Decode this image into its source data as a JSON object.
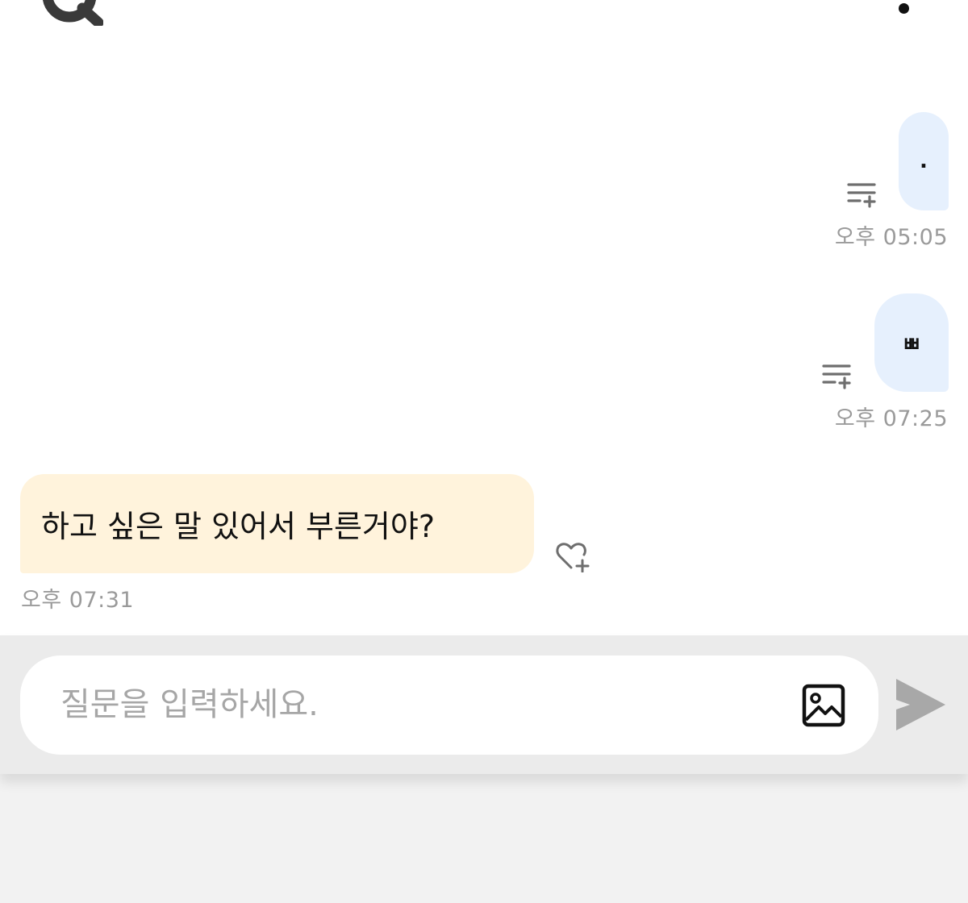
{
  "messages": [
    {
      "sender": "user",
      "text": ".",
      "time": "오후 05:05"
    },
    {
      "sender": "user",
      "text": "ㅃ",
      "time": "오후 07:25"
    },
    {
      "sender": "bot",
      "text": "하고 싶은 말 있어서 부른거야?",
      "time": "오후 07:31"
    }
  ],
  "input": {
    "placeholder": "질문을 입력하세요.",
    "value": ""
  },
  "icons": {
    "logo": "logo-icon",
    "menu": "more-dots-icon",
    "add_note": "playlist-add-icon",
    "like": "heart-plus-icon",
    "image": "image-icon",
    "send": "send-icon"
  },
  "colors": {
    "user_bubble": "#e6f0fd",
    "bot_bubble": "#fff3dc",
    "timestamp": "#9a9a9a",
    "send_button": "#a8a8a8"
  }
}
